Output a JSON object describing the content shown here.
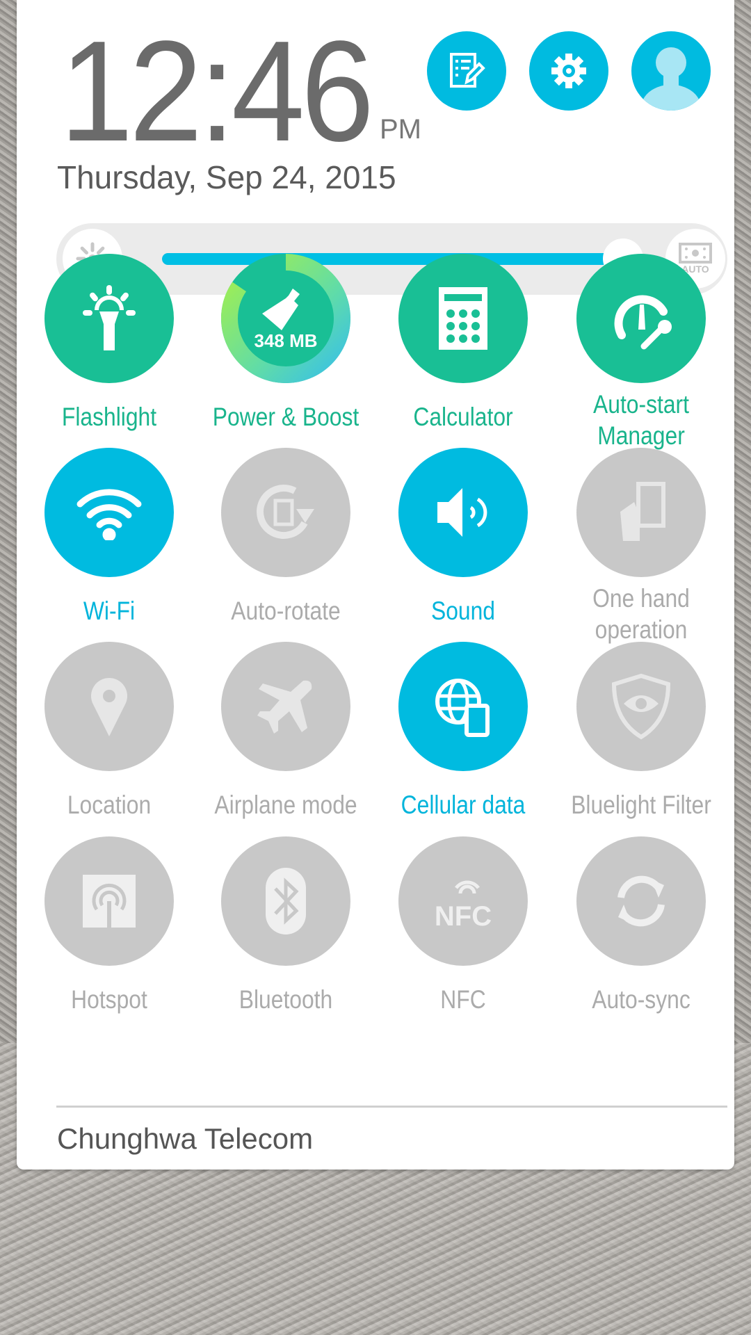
{
  "clock": {
    "time": "12:46",
    "ampm": "PM",
    "date": "Thursday, Sep 24, 2015"
  },
  "top_buttons": [
    {
      "icon": "edit-list-icon"
    },
    {
      "icon": "gear-icon"
    },
    {
      "icon": "user-avatar-icon"
    }
  ],
  "brightness": {
    "level_percent": 95,
    "auto_label": "AUTO"
  },
  "colors": {
    "green": "#19bf95",
    "blue": "#00bbe0",
    "off": "#c8c8c8"
  },
  "tiles": [
    {
      "label": "Flashlight",
      "state": "app"
    },
    {
      "label": "Power & Boost",
      "state": "app",
      "memory": "348 MB"
    },
    {
      "label": "Calculator",
      "state": "app"
    },
    {
      "label": "Auto-start",
      "label2": "Manager",
      "state": "app"
    },
    {
      "label": "Wi-Fi",
      "state": "on"
    },
    {
      "label": "Auto-rotate",
      "state": "off"
    },
    {
      "label": "Sound",
      "state": "on"
    },
    {
      "label": "One hand",
      "label2": "operation",
      "state": "off"
    },
    {
      "label": "Location",
      "state": "off"
    },
    {
      "label": "Airplane mode",
      "state": "off"
    },
    {
      "label": "Cellular data",
      "state": "on"
    },
    {
      "label": "Bluelight Filter",
      "state": "off"
    },
    {
      "label": "Hotspot",
      "state": "off"
    },
    {
      "label": "Bluetooth",
      "state": "off"
    },
    {
      "label": "NFC",
      "state": "off"
    },
    {
      "label": "Auto-sync",
      "state": "off"
    }
  ],
  "carrier": "Chunghwa Telecom"
}
